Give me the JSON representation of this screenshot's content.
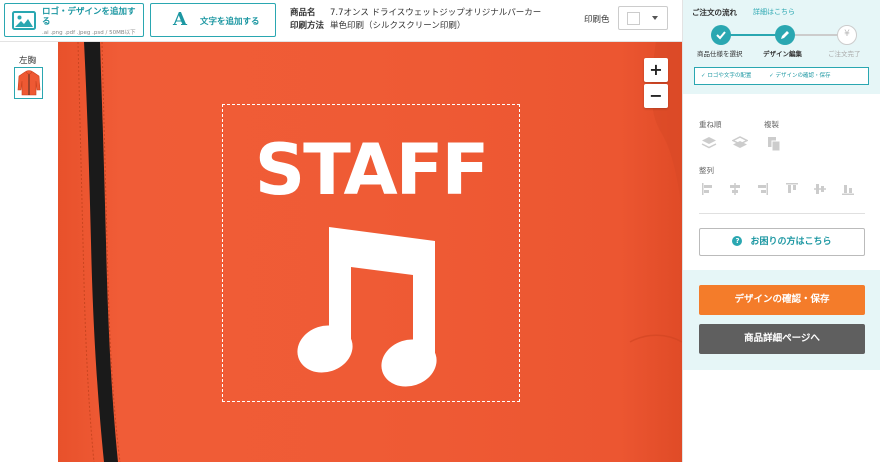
{
  "toolbar": {
    "upload_label": "ロゴ・デザインを追加する",
    "upload_formats": ".ai .png .pdf .jpeg .psd / 50MB以下",
    "add_text_icon": "A",
    "add_text_label": "文字を追加する",
    "product_name_key": "商品名",
    "product_name": "7.7オンス ドライスウェットジップオリジナルパーカー",
    "print_method_key": "印刷方法",
    "print_method": "単色印刷（シルクスクリーン印刷）",
    "print_color_label": "印刷色",
    "print_color_value": "#ffffff"
  },
  "thumbnails": {
    "position_label": "左胸"
  },
  "canvas": {
    "garment_color": "#ee5933",
    "zoom_in": "+",
    "zoom_out": "−",
    "design_text": "STAFF",
    "design_icon": "music-note-icon"
  },
  "order_flow": {
    "title": "ご注文の流れ",
    "detail_link": "詳細はこちら",
    "steps": [
      {
        "label": "商品仕様を選択",
        "state": "done"
      },
      {
        "label": "デザイン編集",
        "state": "current"
      },
      {
        "label": "ご注文完了",
        "state": "todo"
      }
    ],
    "substeps": [
      "ロゴや文字の配置",
      "デザインの確認・保存"
    ]
  },
  "tools": {
    "layer_order_label": "重ね順",
    "duplicate_label": "複製",
    "align_label": "整列",
    "help_button": "お困りの方はこちら"
  },
  "actions": {
    "confirm_save": "デザインの確認・保存",
    "product_detail": "商品詳細ページへ"
  },
  "colors": {
    "accent": "#2aa7b1",
    "confirm": "#f47c2a",
    "secondary": "#5f5f5f"
  }
}
